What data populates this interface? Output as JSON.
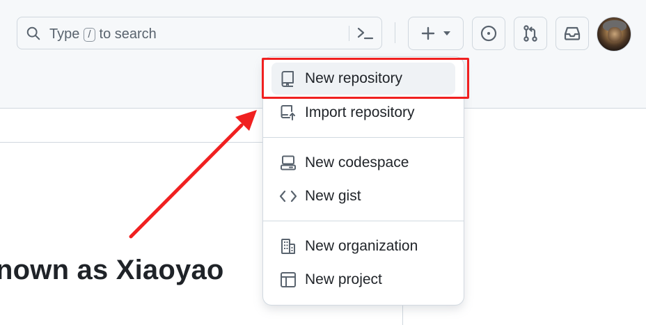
{
  "search": {
    "placeholder_prefix": "Type",
    "shortcut_key": "/",
    "placeholder_suffix": "to search"
  },
  "icons": {
    "search": "search-icon",
    "command_palette": "terminal-icon",
    "create_new": "plus-icon",
    "create_dropdown": "triangle-down-icon",
    "issues": "issue-opened-icon",
    "pull_requests": "git-pull-request-icon",
    "inbox": "inbox-icon"
  },
  "page": {
    "heading_fragment": "nown as Xiaoyao"
  },
  "create_menu": {
    "items": [
      {
        "label": "New repository",
        "icon": "repo-icon",
        "highlighted": true
      },
      {
        "label": "Import repository",
        "icon": "repo-push-icon"
      },
      {
        "label": "New codespace",
        "icon": "codespaces-icon"
      },
      {
        "label": "New gist",
        "icon": "code-icon"
      },
      {
        "label": "New organization",
        "icon": "organization-icon"
      },
      {
        "label": "New project",
        "icon": "table-icon"
      }
    ]
  },
  "colors": {
    "annotation_red": "#f02020",
    "header_bg": "#f6f8fa",
    "border": "#d0d7de",
    "text_primary": "#1f2328",
    "text_muted": "#59636e",
    "active_item_bg": "#eff2f5"
  }
}
